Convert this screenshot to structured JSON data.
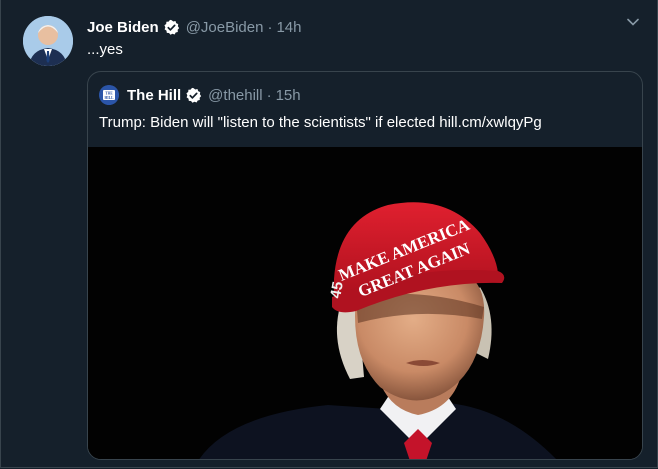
{
  "tweet": {
    "author_name": "Joe Biden",
    "author_handle": "@JoeBiden",
    "separator": "·",
    "timestamp": "14h",
    "text": "...yes",
    "icons": {
      "avatar": "profile-photo",
      "verified": "verified-badge-icon",
      "menu": "chevron-down-icon"
    }
  },
  "quoted_tweet": {
    "author_name": "The Hill",
    "author_handle": "@thehill",
    "separator": "·",
    "timestamp": "15h",
    "text": "Trump: Biden will \"listen to the scientists\" if elected hill.cm/xwlqyPg",
    "avatar_text": "THE HILL",
    "media": {
      "hat_text_line1": "MAKE AMERICA",
      "hat_text_line2": "GREAT AGAIN",
      "hat_side_number": "45"
    }
  },
  "colors": {
    "background": "#15202b",
    "border": "#38444d",
    "secondary_text": "#8899a6",
    "verified_blue": "#ffffff",
    "hat_red": "#d11a2a"
  }
}
